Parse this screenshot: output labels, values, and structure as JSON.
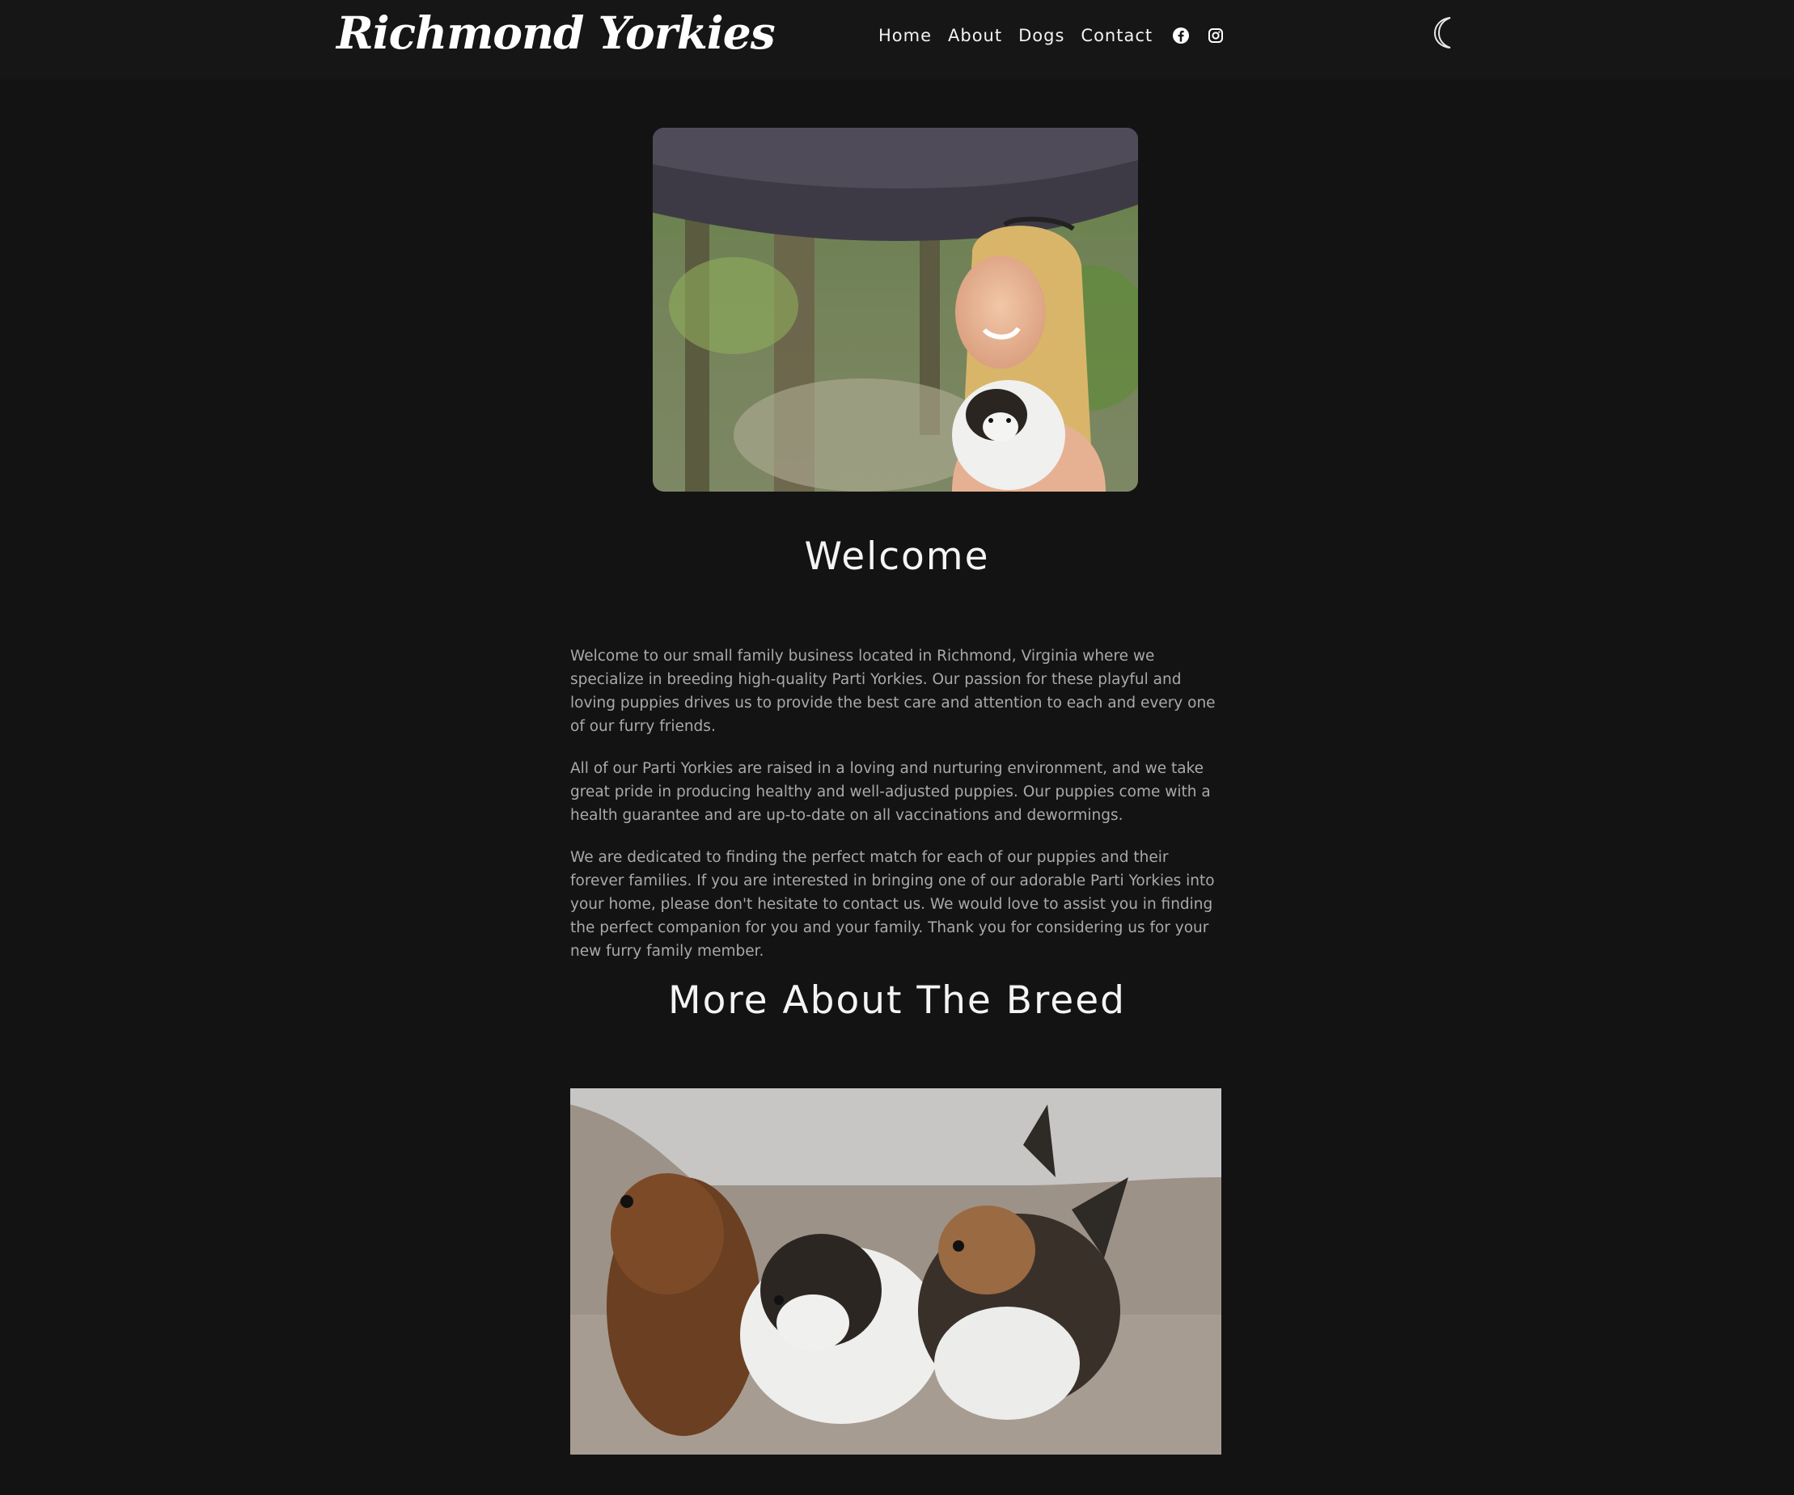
{
  "header": {
    "brand": "Richmond Yorkies",
    "nav": [
      {
        "label": "Home"
      },
      {
        "label": "About"
      },
      {
        "label": "Dogs"
      },
      {
        "label": "Contact"
      }
    ],
    "social_icons": [
      "facebook-icon",
      "instagram-icon"
    ],
    "theme_toggle_icon": "moon-icon"
  },
  "main": {
    "hero_image": "woman-with-umbrella-holding-yorkie-photo",
    "welcome_heading": "Welcome",
    "paragraphs": [
      "Welcome to our small family business located in Richmond, Virginia where we specialize in breeding high-quality Parti Yorkies. Our passion for these playful and loving puppies drives us to provide the best care and attention to each and every one of our furry friends.",
      "All of our Parti Yorkies are raised in a loving and nurturing environment, and we take great pride in producing healthy and well-adjusted puppies. Our puppies come with a health guarantee and are up-to-date on all vaccinations and dewormings.",
      "We are dedicated to finding the perfect match for each of our puppies and their forever families. If you are interested in bringing one of our adorable Parti Yorkies into your home, please don't hesitate to contact us. We would love to assist you in finding the perfect companion for you and your family. Thank you for considering us for your new furry family member."
    ],
    "breed_heading": "More About The Breed",
    "breed_image": "three-yorkies-on-couch-photo"
  },
  "colors": {
    "background": "#131313",
    "navbar": "#161616",
    "heading_text": "#f4f4f4",
    "body_text": "#a9a9a9"
  }
}
